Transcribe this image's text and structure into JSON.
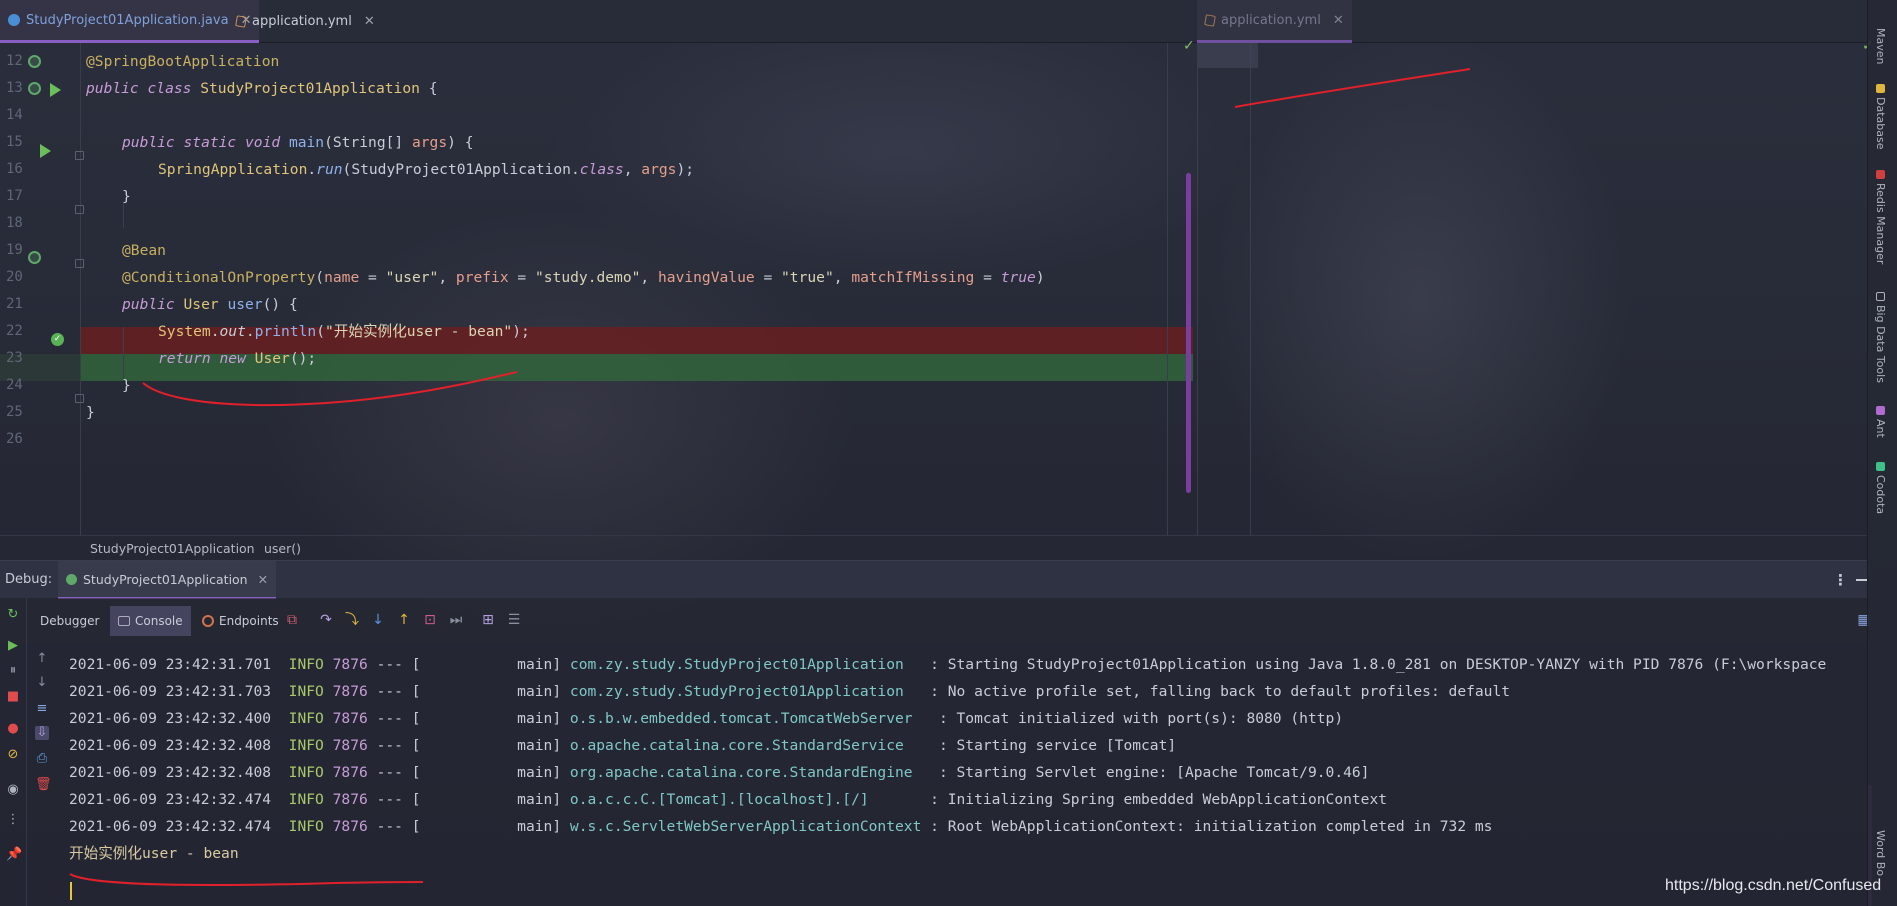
{
  "tabs": [
    {
      "label": "StudyProject01Application.java",
      "type": "java",
      "active": true
    },
    {
      "label": "application.yml",
      "type": "yml",
      "active": false
    },
    {
      "label": "application.yml",
      "type": "yml",
      "active": true
    }
  ],
  "editor": {
    "lines": [
      {
        "no": "12"
      },
      {
        "no": "13"
      },
      {
        "no": "14"
      },
      {
        "no": "15"
      },
      {
        "no": "16"
      },
      {
        "no": "17"
      },
      {
        "no": "18"
      },
      {
        "no": "19"
      },
      {
        "no": "20"
      },
      {
        "no": "21"
      },
      {
        "no": "22"
      },
      {
        "no": "23"
      },
      {
        "no": "24"
      },
      {
        "no": "25"
      },
      {
        "no": "26"
      }
    ],
    "code": {
      "l12": "@SpringBootApplication",
      "l13_kw": "public class",
      "l13_cls": "StudyProject01Application",
      "l13_brace": "{",
      "l15_kw": "public static void",
      "l15_fn": "main",
      "l15_open": "(String[]",
      "l15_param": "args",
      "l15_close": ") {",
      "l16_cls": "SpringApplication",
      "l16_dot": ".",
      "l16_fn": "run",
      "l16_args_a": "(StudyProject01Application.",
      "l16_kw": "class",
      "l16_sep": ", ",
      "l16_param": "args",
      "l16_end": ");",
      "l17": "}",
      "l19": "@Bean",
      "l20_ann": "@ConditionalOnProperty",
      "l20_a1": "name",
      "l20_v1": "\"user\"",
      "l20_a2": "prefix",
      "l20_v2": "\"study.demo\"",
      "l20_a3": "havingValue",
      "l20_v3": "\"true\"",
      "l20_a4": "matchIfMissing",
      "l20_v4": "true",
      "l21_kw": "public",
      "l21_type": "User",
      "l21_fn": "user",
      "l21_end": "() {",
      "l22_cls": "System",
      "l22_fld": "out",
      "l22_fn": "println",
      "l22_str": "\"开始实例化user - bean\"",
      "l22_end": ");",
      "l23_kw": "return new",
      "l23_cls": "User",
      "l23_end": "();",
      "l24": "}",
      "l25": "}"
    }
  },
  "breadcrumb": {
    "item1": "StudyProject01Application",
    "item2": "user()"
  },
  "right_tools": [
    "Maven",
    "Database",
    "Redis Manager",
    "Big Data Tools",
    "Ant",
    "Codota",
    "Word Bo"
  ],
  "debug": {
    "title": "Debug:",
    "session": "StudyProject01Application",
    "tabs": {
      "debugger": "Debugger",
      "console": "Console",
      "endpoints": "Endpoints"
    }
  },
  "console": {
    "lines": [
      {
        "ts": "2021-06-09 23:42:31.701",
        "lvl": "INFO",
        "pid": "7876",
        "sep": "--- [",
        "thread": "main]",
        "logger": "com.zy.study.StudyProject01Application  ",
        "msg": ": Starting StudyProject01Application using Java 1.8.0_281 on DESKTOP-YANZY with PID 7876 (F:\\workspace"
      },
      {
        "ts": "2021-06-09 23:42:31.703",
        "lvl": "INFO",
        "pid": "7876",
        "sep": "--- [",
        "thread": "main]",
        "logger": "com.zy.study.StudyProject01Application  ",
        "msg": ": No active profile set, falling back to default profiles: default"
      },
      {
        "ts": "2021-06-09 23:42:32.400",
        "lvl": "INFO",
        "pid": "7876",
        "sep": "--- [",
        "thread": "main]",
        "logger": "o.s.b.w.embedded.tomcat.TomcatWebServer  ",
        "msg": ": Tomcat initialized with port(s): 8080 (http)"
      },
      {
        "ts": "2021-06-09 23:42:32.408",
        "lvl": "INFO",
        "pid": "7876",
        "sep": "--- [",
        "thread": "main]",
        "logger": "o.apache.catalina.core.StandardService   ",
        "msg": ": Starting service [Tomcat]"
      },
      {
        "ts": "2021-06-09 23:42:32.408",
        "lvl": "INFO",
        "pid": "7876",
        "sep": "--- [",
        "thread": "main]",
        "logger": "org.apache.catalina.core.StandardEngine  ",
        "msg": ": Starting Servlet engine: [Apache Tomcat/9.0.46]"
      },
      {
        "ts": "2021-06-09 23:42:32.474",
        "lvl": "INFO",
        "pid": "7876",
        "sep": "--- [",
        "thread": "main]",
        "logger": "o.a.c.c.C.[Tomcat].[localhost].[/]      ",
        "msg": ": Initializing Spring embedded WebApplicationContext"
      },
      {
        "ts": "2021-06-09 23:42:32.474",
        "lvl": "INFO",
        "pid": "7876",
        "sep": "--- [",
        "thread": "main]",
        "logger": "w.s.c.ServletWebServerApplicationContext",
        "msg": ": Root WebApplicationContext: initialization completed in 732 ms"
      }
    ],
    "output": "开始实例化user - bean"
  },
  "watermark": "https://blog.csdn.net/Confused",
  "colors": {
    "accent": "#8a5fc4",
    "annotation": "#c8b061",
    "keyword": "#c79bd6",
    "breakpoint_line": "#6e1e1e",
    "exec_line": "#32693c"
  }
}
